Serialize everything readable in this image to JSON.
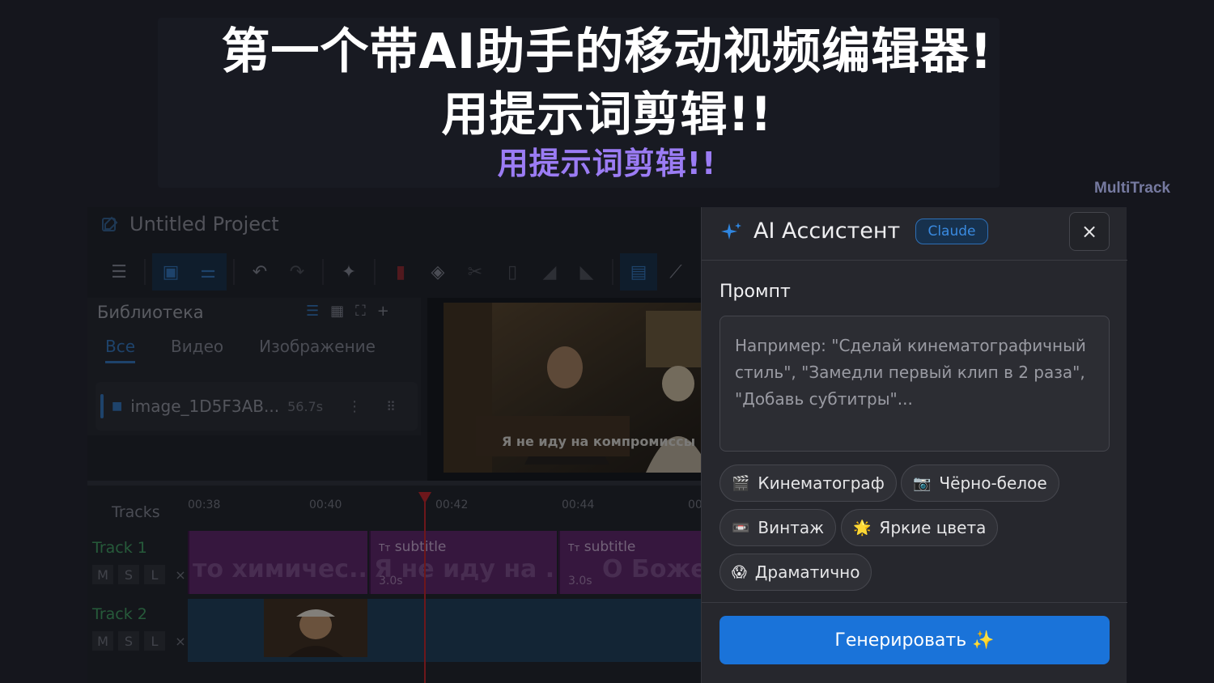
{
  "banner": {
    "headline_1": "第一个带AI助手的移动视频编辑器!",
    "headline_2": "用提示词剪辑!!",
    "headline_3": "用提示词剪辑!!",
    "brand": "MultiTrack",
    "accent_color": "#9b7cf4"
  },
  "editor": {
    "project_title": "Untitled Project",
    "toolbar_icons": [
      "menu-icon",
      "media-icon",
      "adjust-icon",
      "undo-icon",
      "redo-icon",
      "sparkle-icon",
      "marker-icon",
      "tag-icon",
      "scissors-icon",
      "trash-icon",
      "fade-in-icon",
      "fade-out-icon",
      "layout-icon",
      "chart-icon"
    ],
    "library": {
      "title": "Библиотека",
      "tabs": [
        "Все",
        "Видео",
        "Изображение"
      ],
      "active_tab": "Все",
      "item_name": "image_1D5F3AB...",
      "item_duration": "56.7s"
    },
    "preview": {
      "subtitle": "Я не иду на компромиссы"
    },
    "timeline": {
      "tracks_label": "Tracks",
      "ticks": [
        "00:38",
        "00:40",
        "00:42",
        "00:44",
        "00"
      ],
      "tracks": [
        {
          "name": "Track 1",
          "buttons": [
            "M",
            "S",
            "L",
            "×"
          ]
        },
        {
          "name": "Track 2",
          "buttons": [
            "M",
            "S",
            "L",
            "×"
          ]
        }
      ],
      "clips": [
        {
          "label": "",
          "text": "то химичес...",
          "duration": ""
        },
        {
          "label": "subtitle",
          "text": "Я не иду на ...",
          "duration": "3.0s"
        },
        {
          "label": "subtitle",
          "text": "О Боже!",
          "duration": "3.0s"
        }
      ],
      "clip_type_icon": "Tт"
    }
  },
  "ai_panel": {
    "title": "AI Ассистент",
    "badge": "Claude",
    "close_label": "×",
    "prompt_label": "Промпт",
    "prompt_placeholder": "Например: \"Сделай кинематографичный стиль\", \"Замедли первый клип в 2 раза\", \"Добавь субтитры\"...",
    "chips": [
      {
        "icon": "🎬",
        "label": "Кинематограф"
      },
      {
        "icon": "📷",
        "label": "Чёрно-белое"
      },
      {
        "icon": "📼",
        "label": "Винтаж"
      },
      {
        "icon": "🌟",
        "label": "Яркие цвета"
      },
      {
        "icon": "😱",
        "label": "Драматично"
      }
    ],
    "generate_label": "Генерировать ✨",
    "accent_color": "#1a73d9"
  }
}
